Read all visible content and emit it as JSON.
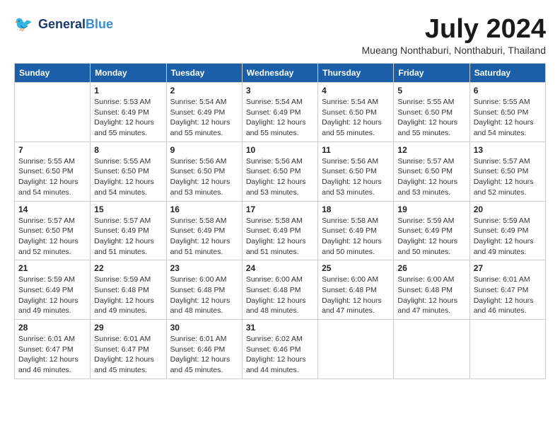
{
  "header": {
    "logo_line1": "General",
    "logo_line2": "Blue",
    "month": "July 2024",
    "location": "Mueang Nonthaburi, Nonthaburi, Thailand"
  },
  "weekdays": [
    "Sunday",
    "Monday",
    "Tuesday",
    "Wednesday",
    "Thursday",
    "Friday",
    "Saturday"
  ],
  "weeks": [
    [
      {
        "day": "",
        "info": ""
      },
      {
        "day": "1",
        "info": "Sunrise: 5:53 AM\nSunset: 6:49 PM\nDaylight: 12 hours\nand 55 minutes."
      },
      {
        "day": "2",
        "info": "Sunrise: 5:54 AM\nSunset: 6:49 PM\nDaylight: 12 hours\nand 55 minutes."
      },
      {
        "day": "3",
        "info": "Sunrise: 5:54 AM\nSunset: 6:49 PM\nDaylight: 12 hours\nand 55 minutes."
      },
      {
        "day": "4",
        "info": "Sunrise: 5:54 AM\nSunset: 6:50 PM\nDaylight: 12 hours\nand 55 minutes."
      },
      {
        "day": "5",
        "info": "Sunrise: 5:55 AM\nSunset: 6:50 PM\nDaylight: 12 hours\nand 55 minutes."
      },
      {
        "day": "6",
        "info": "Sunrise: 5:55 AM\nSunset: 6:50 PM\nDaylight: 12 hours\nand 54 minutes."
      }
    ],
    [
      {
        "day": "7",
        "info": "Sunrise: 5:55 AM\nSunset: 6:50 PM\nDaylight: 12 hours\nand 54 minutes."
      },
      {
        "day": "8",
        "info": "Sunrise: 5:55 AM\nSunset: 6:50 PM\nDaylight: 12 hours\nand 54 minutes."
      },
      {
        "day": "9",
        "info": "Sunrise: 5:56 AM\nSunset: 6:50 PM\nDaylight: 12 hours\nand 53 minutes."
      },
      {
        "day": "10",
        "info": "Sunrise: 5:56 AM\nSunset: 6:50 PM\nDaylight: 12 hours\nand 53 minutes."
      },
      {
        "day": "11",
        "info": "Sunrise: 5:56 AM\nSunset: 6:50 PM\nDaylight: 12 hours\nand 53 minutes."
      },
      {
        "day": "12",
        "info": "Sunrise: 5:57 AM\nSunset: 6:50 PM\nDaylight: 12 hours\nand 53 minutes."
      },
      {
        "day": "13",
        "info": "Sunrise: 5:57 AM\nSunset: 6:50 PM\nDaylight: 12 hours\nand 52 minutes."
      }
    ],
    [
      {
        "day": "14",
        "info": "Sunrise: 5:57 AM\nSunset: 6:50 PM\nDaylight: 12 hours\nand 52 minutes."
      },
      {
        "day": "15",
        "info": "Sunrise: 5:57 AM\nSunset: 6:49 PM\nDaylight: 12 hours\nand 51 minutes."
      },
      {
        "day": "16",
        "info": "Sunrise: 5:58 AM\nSunset: 6:49 PM\nDaylight: 12 hours\nand 51 minutes."
      },
      {
        "day": "17",
        "info": "Sunrise: 5:58 AM\nSunset: 6:49 PM\nDaylight: 12 hours\nand 51 minutes."
      },
      {
        "day": "18",
        "info": "Sunrise: 5:58 AM\nSunset: 6:49 PM\nDaylight: 12 hours\nand 50 minutes."
      },
      {
        "day": "19",
        "info": "Sunrise: 5:59 AM\nSunset: 6:49 PM\nDaylight: 12 hours\nand 50 minutes."
      },
      {
        "day": "20",
        "info": "Sunrise: 5:59 AM\nSunset: 6:49 PM\nDaylight: 12 hours\nand 49 minutes."
      }
    ],
    [
      {
        "day": "21",
        "info": "Sunrise: 5:59 AM\nSunset: 6:49 PM\nDaylight: 12 hours\nand 49 minutes."
      },
      {
        "day": "22",
        "info": "Sunrise: 5:59 AM\nSunset: 6:48 PM\nDaylight: 12 hours\nand 49 minutes."
      },
      {
        "day": "23",
        "info": "Sunrise: 6:00 AM\nSunset: 6:48 PM\nDaylight: 12 hours\nand 48 minutes."
      },
      {
        "day": "24",
        "info": "Sunrise: 6:00 AM\nSunset: 6:48 PM\nDaylight: 12 hours\nand 48 minutes."
      },
      {
        "day": "25",
        "info": "Sunrise: 6:00 AM\nSunset: 6:48 PM\nDaylight: 12 hours\nand 47 minutes."
      },
      {
        "day": "26",
        "info": "Sunrise: 6:00 AM\nSunset: 6:48 PM\nDaylight: 12 hours\nand 47 minutes."
      },
      {
        "day": "27",
        "info": "Sunrise: 6:01 AM\nSunset: 6:47 PM\nDaylight: 12 hours\nand 46 minutes."
      }
    ],
    [
      {
        "day": "28",
        "info": "Sunrise: 6:01 AM\nSunset: 6:47 PM\nDaylight: 12 hours\nand 46 minutes."
      },
      {
        "day": "29",
        "info": "Sunrise: 6:01 AM\nSunset: 6:47 PM\nDaylight: 12 hours\nand 45 minutes."
      },
      {
        "day": "30",
        "info": "Sunrise: 6:01 AM\nSunset: 6:46 PM\nDaylight: 12 hours\nand 45 minutes."
      },
      {
        "day": "31",
        "info": "Sunrise: 6:02 AM\nSunset: 6:46 PM\nDaylight: 12 hours\nand 44 minutes."
      },
      {
        "day": "",
        "info": ""
      },
      {
        "day": "",
        "info": ""
      },
      {
        "day": "",
        "info": ""
      }
    ]
  ]
}
